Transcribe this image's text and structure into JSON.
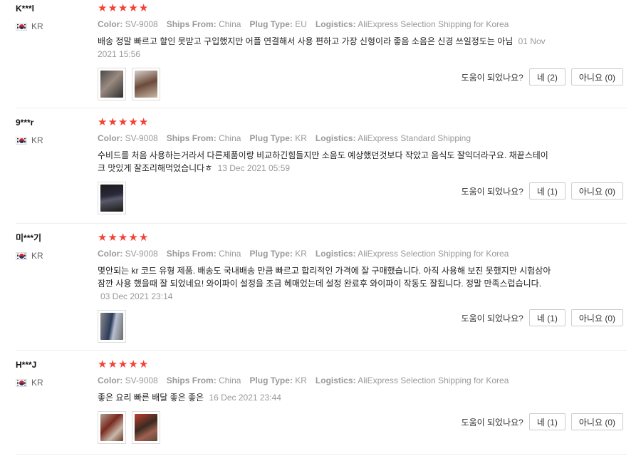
{
  "helpful_label": "도움이 되었나요?",
  "reviews": [
    {
      "user": "K***l",
      "country": "KR",
      "stars": 5,
      "color_label": "Color:",
      "color": "SV-9008",
      "ships_label": "Ships From:",
      "ships": "China",
      "plug_label": "Plug Type:",
      "plug": "EU",
      "logistics_label": "Logistics:",
      "logistics": "AliExpress Selection Shipping for Korea",
      "text": "배송 정말 빠르고 할인 못받고 구입했지만 어플 연결해서 사용 편하고 가장 신형이라 좋음 소음은 신경 쓰일정도는 아님",
      "date": "01 Nov 2021 15:56",
      "yes": "네 (2)",
      "no": "아니요 (0)"
    },
    {
      "user": "9***r",
      "country": "KR",
      "stars": 5,
      "color_label": "Color:",
      "color": "SV-9008",
      "ships_label": "Ships From:",
      "ships": "China",
      "plug_label": "Plug Type:",
      "plug": "KR",
      "logistics_label": "Logistics:",
      "logistics": "AliExpress Standard Shipping",
      "text": "수비드를 처음 사용하는거라서 다른제품이랑 비교하긴힘들지만 소음도 예상했던것보다 작았고 음식도 잘익더라구요. 채끝스테이크 맛있게 잘조리해먹었습니다ㅎ",
      "date": "13 Dec 2021 05:59",
      "yes": "네 (1)",
      "no": "아니요 (0)"
    },
    {
      "user": "미***기",
      "country": "KR",
      "stars": 5,
      "color_label": "Color:",
      "color": "SV-9008",
      "ships_label": "Ships From:",
      "ships": "China",
      "plug_label": "Plug Type:",
      "plug": "KR",
      "logistics_label": "Logistics:",
      "logistics": "AliExpress Selection Shipping for Korea",
      "text": "몇안되는 kr 코드 유형 제품. 배송도 국내배송 만큼 빠르고 합리적인 가격에 잘 구매했습니다. 아직 사용해 보진 못했지만 시험삼아 잠깐 사용 했을때 잘 되었네요! 와이파이 설정을 조금 헤매었는데 설정 완료후 와이파이 작동도 잘됩니다. 정말 만족스럽습니다.",
      "date": "03 Dec 2021 23:14",
      "yes": "네 (1)",
      "no": "아니요 (0)"
    },
    {
      "user": "H***J",
      "country": "KR",
      "stars": 5,
      "color_label": "Color:",
      "color": "SV-9008",
      "ships_label": "Ships From:",
      "ships": "China",
      "plug_label": "Plug Type:",
      "plug": "KR",
      "logistics_label": "Logistics:",
      "logistics": "AliExpress Selection Shipping for Korea",
      "text": "좋은 요리 빠른 배달 좋은 좋은",
      "date": "16 Dec 2021 23:44",
      "yes": "네 (1)",
      "no": "아니요 (0)"
    }
  ],
  "colors": {
    "star": "#f44336",
    "meta": "#999999",
    "border": "#eeeeee"
  }
}
